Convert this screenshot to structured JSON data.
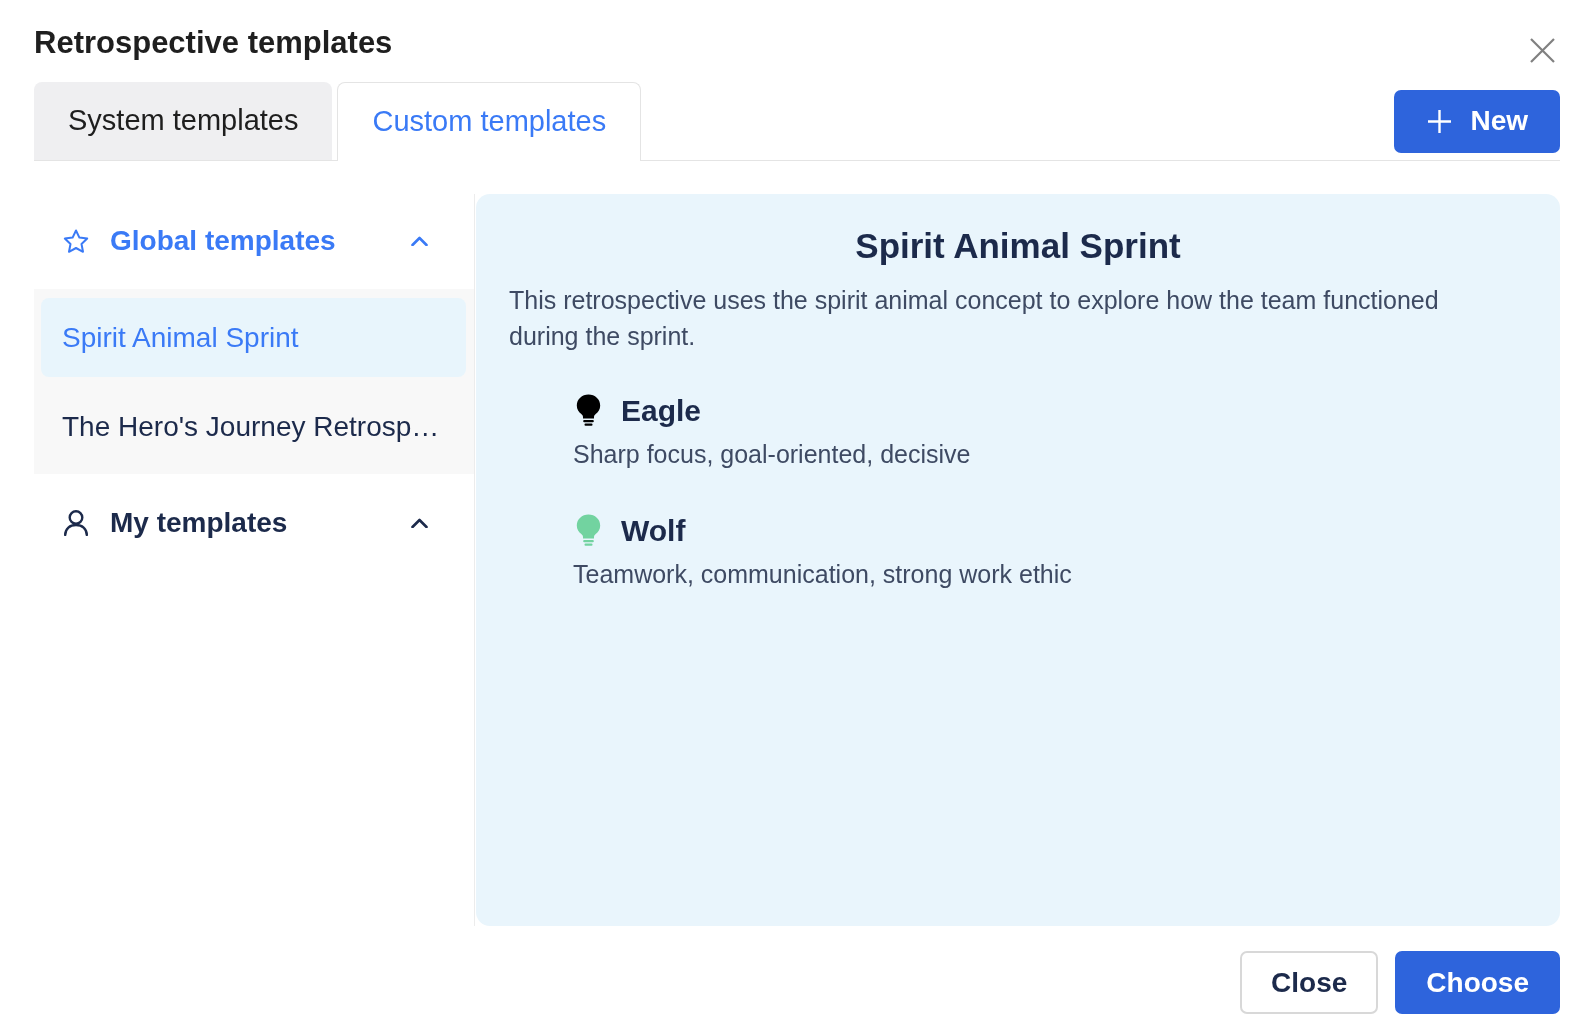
{
  "dialog": {
    "title": "Retrospective templates"
  },
  "tabs": [
    {
      "label": "System templates",
      "selected": false
    },
    {
      "label": "Custom templates",
      "selected": true
    }
  ],
  "new_button": {
    "label": "New"
  },
  "sidebar": {
    "groups": [
      {
        "kind": "global",
        "title": "Global templates",
        "selected": true,
        "expanded": true,
        "items": [
          {
            "label": "Spirit Animal Sprint",
            "selected": true
          },
          {
            "label": "The Hero's Journey Retrosp…",
            "selected": false
          }
        ]
      },
      {
        "kind": "personal",
        "title": "My templates",
        "selected": false,
        "expanded": true
      }
    ]
  },
  "preview": {
    "title": "Spirit Animal Sprint",
    "description": "This retrospective uses the spirit animal concept to explore how the team functioned during the sprint.",
    "columns": [
      {
        "name": "Eagle",
        "description": "Sharp focus, goal-oriented, decisive",
        "color": "#000000"
      },
      {
        "name": "Wolf",
        "description": "Teamwork, communication, strong work ethic",
        "color": "#72d3a0"
      }
    ]
  },
  "footer_buttons": [
    {
      "label": "Close",
      "kind": "secondary"
    },
    {
      "label": "Choose",
      "kind": "primary"
    }
  ]
}
